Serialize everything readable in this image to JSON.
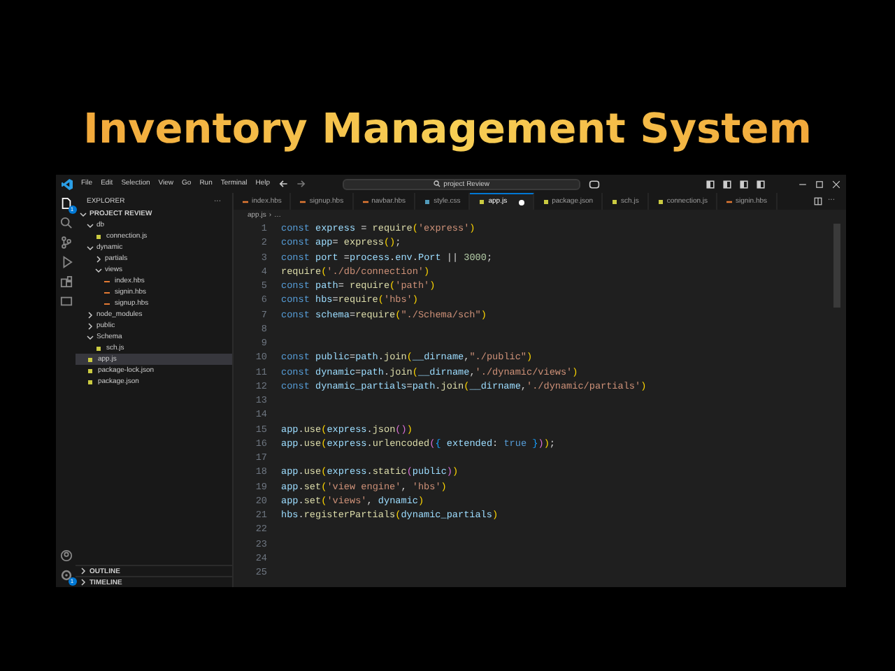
{
  "headline": "Inventory Management System",
  "menu": [
    "File",
    "Edit",
    "Selection",
    "View",
    "Go",
    "Run",
    "Terminal",
    "Help"
  ],
  "search": {
    "value": "project Review"
  },
  "activity_badges": [
    "1",
    "1"
  ],
  "explorer": {
    "title": "EXPLORER",
    "more": "···",
    "root": "PROJECT REVIEW",
    "tree": [
      {
        "label": "db",
        "kind": "folder",
        "expanded": true,
        "selected": false,
        "children": [
          {
            "label": "connection.js",
            "kind": "js",
            "selected": false
          }
        ]
      },
      {
        "label": "dynamic",
        "kind": "folder",
        "expanded": true,
        "selected": false,
        "children": [
          {
            "label": "partials",
            "kind": "folder",
            "expanded": false,
            "selected": false
          },
          {
            "label": "views",
            "kind": "folder",
            "expanded": true,
            "selected": false,
            "children": [
              {
                "label": "index.hbs",
                "kind": "hbs",
                "selected": false
              },
              {
                "label": "signin.hbs",
                "kind": "hbs",
                "selected": false
              },
              {
                "label": "signup.hbs",
                "kind": "hbs",
                "selected": false
              }
            ]
          }
        ]
      },
      {
        "label": "node_modules",
        "kind": "folder",
        "expanded": false,
        "selected": false
      },
      {
        "label": "public",
        "kind": "folder",
        "expanded": false,
        "selected": false
      },
      {
        "label": "Schema",
        "kind": "folder",
        "expanded": true,
        "selected": false,
        "children": [
          {
            "label": "sch.js",
            "kind": "js",
            "selected": false
          }
        ]
      },
      {
        "label": "app.js",
        "kind": "js",
        "selected": true
      },
      {
        "label": "package-lock.json",
        "kind": "json",
        "selected": false
      },
      {
        "label": "package.json",
        "kind": "json",
        "selected": false
      }
    ],
    "panels": [
      "OUTLINE",
      "TIMELINE"
    ]
  },
  "tabs": [
    {
      "label": "index.hbs",
      "kind": "hbs",
      "selected": false,
      "modified": false
    },
    {
      "label": "signup.hbs",
      "kind": "hbs",
      "selected": false,
      "modified": false
    },
    {
      "label": "navbar.hbs",
      "kind": "hbs",
      "selected": false,
      "modified": false
    },
    {
      "label": "style.css",
      "kind": "css",
      "selected": false,
      "modified": false
    },
    {
      "label": "app.js",
      "kind": "js",
      "selected": true,
      "modified": true
    },
    {
      "label": "package.json",
      "kind": "json",
      "selected": false,
      "modified": false
    },
    {
      "label": "sch.js",
      "kind": "js",
      "selected": false,
      "modified": false
    },
    {
      "label": "connection.js",
      "kind": "js",
      "selected": false,
      "modified": false
    },
    {
      "label": "signin.hbs",
      "kind": "hbs",
      "selected": false,
      "modified": false
    }
  ],
  "editor_more": "···",
  "breadcrumb": [
    "app.js",
    "›",
    "…"
  ],
  "code": [
    {
      "number": "1",
      "tokens": [
        {
          "kind": "keyword",
          "text": "const "
        },
        {
          "kind": "variable",
          "text": "express"
        },
        {
          "kind": "plain",
          "text": " = "
        },
        {
          "kind": "function",
          "text": "require"
        },
        {
          "kind": "bracket",
          "text": "("
        },
        {
          "kind": "string",
          "text": "'express'"
        },
        {
          "kind": "bracket",
          "text": ")"
        }
      ]
    },
    {
      "number": "2",
      "tokens": [
        {
          "kind": "keyword",
          "text": "const "
        },
        {
          "kind": "variable",
          "text": "app"
        },
        {
          "kind": "plain",
          "text": "= "
        },
        {
          "kind": "function",
          "text": "express"
        },
        {
          "kind": "bracket",
          "text": "()"
        },
        {
          "kind": "plain",
          "text": ";"
        }
      ]
    },
    {
      "number": "3",
      "tokens": [
        {
          "kind": "keyword",
          "text": "const "
        },
        {
          "kind": "variable",
          "text": "port"
        },
        {
          "kind": "plain",
          "text": " ="
        },
        {
          "kind": "variable",
          "text": "process"
        },
        {
          "kind": "plain",
          "text": "."
        },
        {
          "kind": "variable",
          "text": "env"
        },
        {
          "kind": "plain",
          "text": "."
        },
        {
          "kind": "variable",
          "text": "Port"
        },
        {
          "kind": "plain",
          "text": " || "
        },
        {
          "kind": "number",
          "text": "3000"
        },
        {
          "kind": "plain",
          "text": ";"
        }
      ]
    },
    {
      "number": "4",
      "tokens": [
        {
          "kind": "function",
          "text": "require"
        },
        {
          "kind": "bracket",
          "text": "("
        },
        {
          "kind": "string",
          "text": "'./db/connection'"
        },
        {
          "kind": "bracket",
          "text": ")"
        }
      ]
    },
    {
      "number": "5",
      "tokens": [
        {
          "kind": "keyword",
          "text": "const "
        },
        {
          "kind": "variable",
          "text": "path"
        },
        {
          "kind": "plain",
          "text": "= "
        },
        {
          "kind": "function",
          "text": "require"
        },
        {
          "kind": "bracket",
          "text": "("
        },
        {
          "kind": "string",
          "text": "'path'"
        },
        {
          "kind": "bracket",
          "text": ")"
        }
      ]
    },
    {
      "number": "6",
      "tokens": [
        {
          "kind": "keyword",
          "text": "const "
        },
        {
          "kind": "variable",
          "text": "hbs"
        },
        {
          "kind": "plain",
          "text": "="
        },
        {
          "kind": "function",
          "text": "require"
        },
        {
          "kind": "bracket",
          "text": "("
        },
        {
          "kind": "string",
          "text": "'hbs'"
        },
        {
          "kind": "bracket",
          "text": ")"
        }
      ]
    },
    {
      "number": "7",
      "tokens": [
        {
          "kind": "keyword",
          "text": "const "
        },
        {
          "kind": "variable",
          "text": "schema"
        },
        {
          "kind": "plain",
          "text": "="
        },
        {
          "kind": "function",
          "text": "require"
        },
        {
          "kind": "bracket",
          "text": "("
        },
        {
          "kind": "string",
          "text": "\"./Schema/sch\""
        },
        {
          "kind": "bracket",
          "text": ")"
        }
      ]
    },
    {
      "number": "8"
    },
    {
      "number": "9"
    },
    {
      "number": "10",
      "tokens": [
        {
          "kind": "keyword",
          "text": "const "
        },
        {
          "kind": "variable",
          "text": "public"
        },
        {
          "kind": "plain",
          "text": "="
        },
        {
          "kind": "variable",
          "text": "path"
        },
        {
          "kind": "plain",
          "text": "."
        },
        {
          "kind": "function",
          "text": "join"
        },
        {
          "kind": "bracket",
          "text": "("
        },
        {
          "kind": "variable",
          "text": "__dirname"
        },
        {
          "kind": "plain",
          "text": ","
        },
        {
          "kind": "string",
          "text": "\"./public\""
        },
        {
          "kind": "bracket",
          "text": ")"
        }
      ]
    },
    {
      "number": "11",
      "tokens": [
        {
          "kind": "keyword",
          "text": "const "
        },
        {
          "kind": "variable",
          "text": "dynamic"
        },
        {
          "kind": "plain",
          "text": "="
        },
        {
          "kind": "variable",
          "text": "path"
        },
        {
          "kind": "plain",
          "text": "."
        },
        {
          "kind": "function",
          "text": "join"
        },
        {
          "kind": "bracket",
          "text": "("
        },
        {
          "kind": "variable",
          "text": "__dirname"
        },
        {
          "kind": "plain",
          "text": ","
        },
        {
          "kind": "string",
          "text": "'./dynamic/views'"
        },
        {
          "kind": "bracket",
          "text": ")"
        }
      ]
    },
    {
      "number": "12",
      "tokens": [
        {
          "kind": "keyword",
          "text": "const "
        },
        {
          "kind": "variable",
          "text": "dynamic_partials"
        },
        {
          "kind": "plain",
          "text": "="
        },
        {
          "kind": "variable",
          "text": "path"
        },
        {
          "kind": "plain",
          "text": "."
        },
        {
          "kind": "function",
          "text": "join"
        },
        {
          "kind": "bracket",
          "text": "("
        },
        {
          "kind": "variable",
          "text": "__dirname"
        },
        {
          "kind": "plain",
          "text": ","
        },
        {
          "kind": "string",
          "text": "'./dynamic/partials'"
        },
        {
          "kind": "bracket",
          "text": ")"
        }
      ]
    },
    {
      "number": "13"
    },
    {
      "number": "14"
    },
    {
      "number": "15",
      "tokens": [
        {
          "kind": "variable",
          "text": "app"
        },
        {
          "kind": "plain",
          "text": "."
        },
        {
          "kind": "function",
          "text": "use"
        },
        {
          "kind": "bracket",
          "text": "("
        },
        {
          "kind": "variable",
          "text": "express"
        },
        {
          "kind": "plain",
          "text": "."
        },
        {
          "kind": "function",
          "text": "json"
        },
        {
          "kind": "bracket2",
          "text": "()"
        },
        {
          "kind": "bracket",
          "text": ")"
        }
      ]
    },
    {
      "number": "16",
      "tokens": [
        {
          "kind": "variable",
          "text": "app"
        },
        {
          "kind": "plain",
          "text": "."
        },
        {
          "kind": "function",
          "text": "use"
        },
        {
          "kind": "bracket",
          "text": "("
        },
        {
          "kind": "variable",
          "text": "express"
        },
        {
          "kind": "plain",
          "text": "."
        },
        {
          "kind": "function",
          "text": "urlencoded"
        },
        {
          "kind": "bracket2",
          "text": "("
        },
        {
          "kind": "bracket3",
          "text": "{ "
        },
        {
          "kind": "variable",
          "text": "extended"
        },
        {
          "kind": "plain",
          "text": ": "
        },
        {
          "kind": "keyword",
          "text": "true "
        },
        {
          "kind": "bracket3",
          "text": "}"
        },
        {
          "kind": "bracket2",
          "text": ")"
        },
        {
          "kind": "bracket",
          "text": ")"
        },
        {
          "kind": "plain",
          "text": ";"
        }
      ]
    },
    {
      "number": "17"
    },
    {
      "number": "18",
      "tokens": [
        {
          "kind": "variable",
          "text": "app"
        },
        {
          "kind": "plain",
          "text": "."
        },
        {
          "kind": "function",
          "text": "use"
        },
        {
          "kind": "bracket",
          "text": "("
        },
        {
          "kind": "variable",
          "text": "express"
        },
        {
          "kind": "plain",
          "text": "."
        },
        {
          "kind": "function",
          "text": "static"
        },
        {
          "kind": "bracket2",
          "text": "("
        },
        {
          "kind": "variable",
          "text": "public"
        },
        {
          "kind": "bracket2",
          "text": ")"
        },
        {
          "kind": "bracket",
          "text": ")"
        }
      ]
    },
    {
      "number": "19",
      "tokens": [
        {
          "kind": "variable",
          "text": "app"
        },
        {
          "kind": "plain",
          "text": "."
        },
        {
          "kind": "function",
          "text": "set"
        },
        {
          "kind": "bracket",
          "text": "("
        },
        {
          "kind": "string",
          "text": "'view engine'"
        },
        {
          "kind": "plain",
          "text": ", "
        },
        {
          "kind": "string",
          "text": "'hbs'"
        },
        {
          "kind": "bracket",
          "text": ")"
        }
      ]
    },
    {
      "number": "20",
      "tokens": [
        {
          "kind": "variable",
          "text": "app"
        },
        {
          "kind": "plain",
          "text": "."
        },
        {
          "kind": "function",
          "text": "set"
        },
        {
          "kind": "bracket",
          "text": "("
        },
        {
          "kind": "string",
          "text": "'views'"
        },
        {
          "kind": "plain",
          "text": ", "
        },
        {
          "kind": "variable",
          "text": "dynamic"
        },
        {
          "kind": "bracket",
          "text": ")"
        }
      ]
    },
    {
      "number": "21",
      "tokens": [
        {
          "kind": "variable",
          "text": "hbs"
        },
        {
          "kind": "plain",
          "text": "."
        },
        {
          "kind": "function",
          "text": "registerPartials"
        },
        {
          "kind": "bracket",
          "text": "("
        },
        {
          "kind": "variable",
          "text": "dynamic_partials"
        },
        {
          "kind": "bracket",
          "text": ")"
        }
      ]
    },
    {
      "number": "22"
    },
    {
      "number": "23"
    },
    {
      "number": "24"
    },
    {
      "number": "25"
    }
  ]
}
